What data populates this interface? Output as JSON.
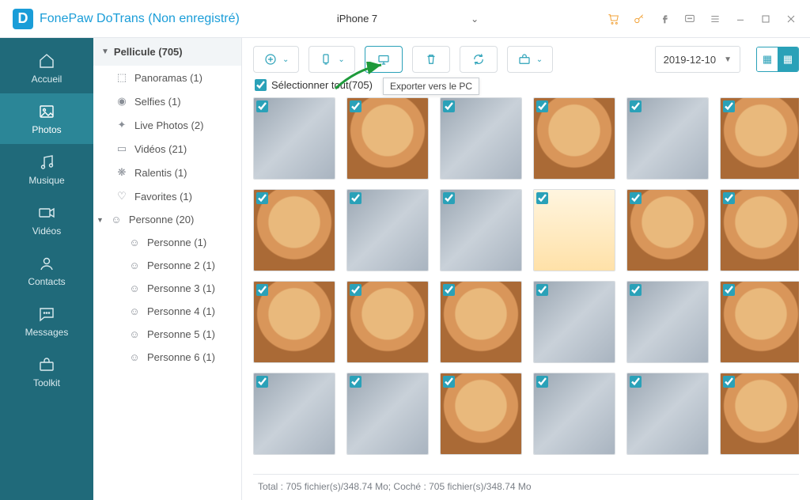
{
  "app": {
    "title": "FonePaw DoTrans (Non enregistré)",
    "device": "iPhone 7"
  },
  "nav": {
    "home": "Accueil",
    "photos": "Photos",
    "music": "Musique",
    "videos": "Vidéos",
    "contacts": "Contacts",
    "messages": "Messages",
    "toolkit": "Toolkit"
  },
  "tree": {
    "root": "Pellicule (705)",
    "items": [
      {
        "icon": "⬚",
        "label": "Panoramas (1)"
      },
      {
        "icon": "◉",
        "label": "Selfies (1)"
      },
      {
        "icon": "✦",
        "label": "Live Photos (2)"
      },
      {
        "icon": "▭",
        "label": "Vidéos (21)"
      },
      {
        "icon": "❋",
        "label": "Ralentis (1)"
      },
      {
        "icon": "♡",
        "label": "Favorites (1)"
      }
    ],
    "person": {
      "label": "Personne (20)"
    },
    "persons": [
      {
        "label": "Personne (1)"
      },
      {
        "label": "Personne 2 (1)"
      },
      {
        "label": "Personne 3 (1)"
      },
      {
        "label": "Personne 4 (1)"
      },
      {
        "label": "Personne 5 (1)"
      },
      {
        "label": "Personne 6 (1)"
      }
    ]
  },
  "toolbar": {
    "export_tooltip": "Exporter vers le PC",
    "date": "2019-12-10"
  },
  "selectall": {
    "label": "Sélectionner tout(705)"
  },
  "grid": {
    "items": [
      {
        "t": "cat"
      },
      {
        "t": "shiba"
      },
      {
        "t": "cat"
      },
      {
        "t": "shiba"
      },
      {
        "t": "cat"
      },
      {
        "t": "shiba"
      },
      {
        "t": "shiba"
      },
      {
        "t": "cat"
      },
      {
        "t": "cat"
      },
      {
        "t": "cart"
      },
      {
        "t": "shiba"
      },
      {
        "t": "shiba"
      },
      {
        "t": "shiba"
      },
      {
        "t": "shiba"
      },
      {
        "t": "shiba"
      },
      {
        "t": "cat"
      },
      {
        "t": "cat"
      },
      {
        "t": "shiba"
      },
      {
        "t": "cat"
      },
      {
        "t": "cat"
      },
      {
        "t": "shiba"
      },
      {
        "t": "cat"
      },
      {
        "t": "cat"
      },
      {
        "t": "shiba"
      }
    ]
  },
  "footer": {
    "text": "Total : 705 fichier(s)/348.74 Mo; Coché : 705 fichier(s)/348.74 Mo"
  }
}
